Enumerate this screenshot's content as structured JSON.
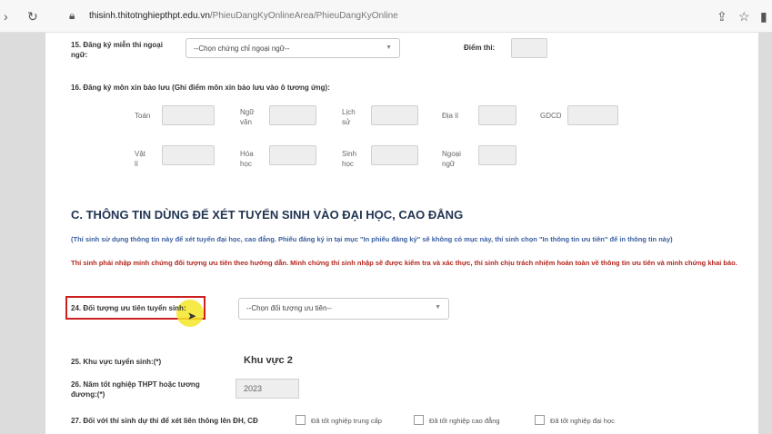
{
  "browser": {
    "url_host": "thisinh.thitotnghiepthpt.edu.vn",
    "url_path": "/PhieuDangKyOnlineArea/PhieuDangKyOnline"
  },
  "form": {
    "q15_label": "15. Đăng ký miễn thi ngoại ngữ:",
    "q15_select": "--Chọn chứng chỉ ngoại ngữ--",
    "score_label": "Điểm thi:",
    "q16_label": "16. Đăng ký môn xin bảo lưu (Ghi điểm môn xin bảo lưu vào ô tương ứng):",
    "subjects_row1": [
      "Toán",
      "Ngữ văn",
      "Lịch sử",
      "Địa lí",
      "GDCD"
    ],
    "subjects_row2": [
      "Vật lí",
      "Hóa học",
      "Sinh học",
      "Ngoại ngữ"
    ],
    "section_c_title": "C. THÔNG TIN DÙNG ĐỂ XÉT TUYỂN SINH VÀO ĐẠI HỌC, CAO ĐẲNG",
    "note_blue": "(Thí sinh sử dụng thông tin này để xét tuyển đại học, cao đẳng. Phiếu đăng ký in tại mục \"In phiếu đăng ký\" sẽ không có mục này, thí sinh chọn \"In thông tin ưu tiên\" để in thông tin này)",
    "note_red": "Thí sinh phải nhập minh chứng đối tượng ưu tiên theo hướng dẫn. Minh chứng thí sinh nhập sẽ được kiểm tra và xác thực, thí sinh chịu trách nhiệm hoàn toàn về thông tin ưu tiên và minh chứng khai báo.",
    "q24_label": "24. Đối tượng ưu tiên tuyển sinh:",
    "q24_select": "--Chọn đối tượng ưu tiên--",
    "q25_label": "25. Khu vực tuyển sinh:(*)",
    "q25_value": "Khu vực 2",
    "q26_label": "26. Năm tốt nghiệp THPT hoặc tương đương:(*)",
    "q26_value": "2023",
    "q27_label": "27. Đối với thí sinh dự thi để xét liên thông lên ĐH, CĐ",
    "q27_options": [
      "Đã tốt nghiệp trung cấp",
      "Đã tốt nghiệp cao đẳng",
      "Đã tốt nghiệp đại học"
    ]
  }
}
